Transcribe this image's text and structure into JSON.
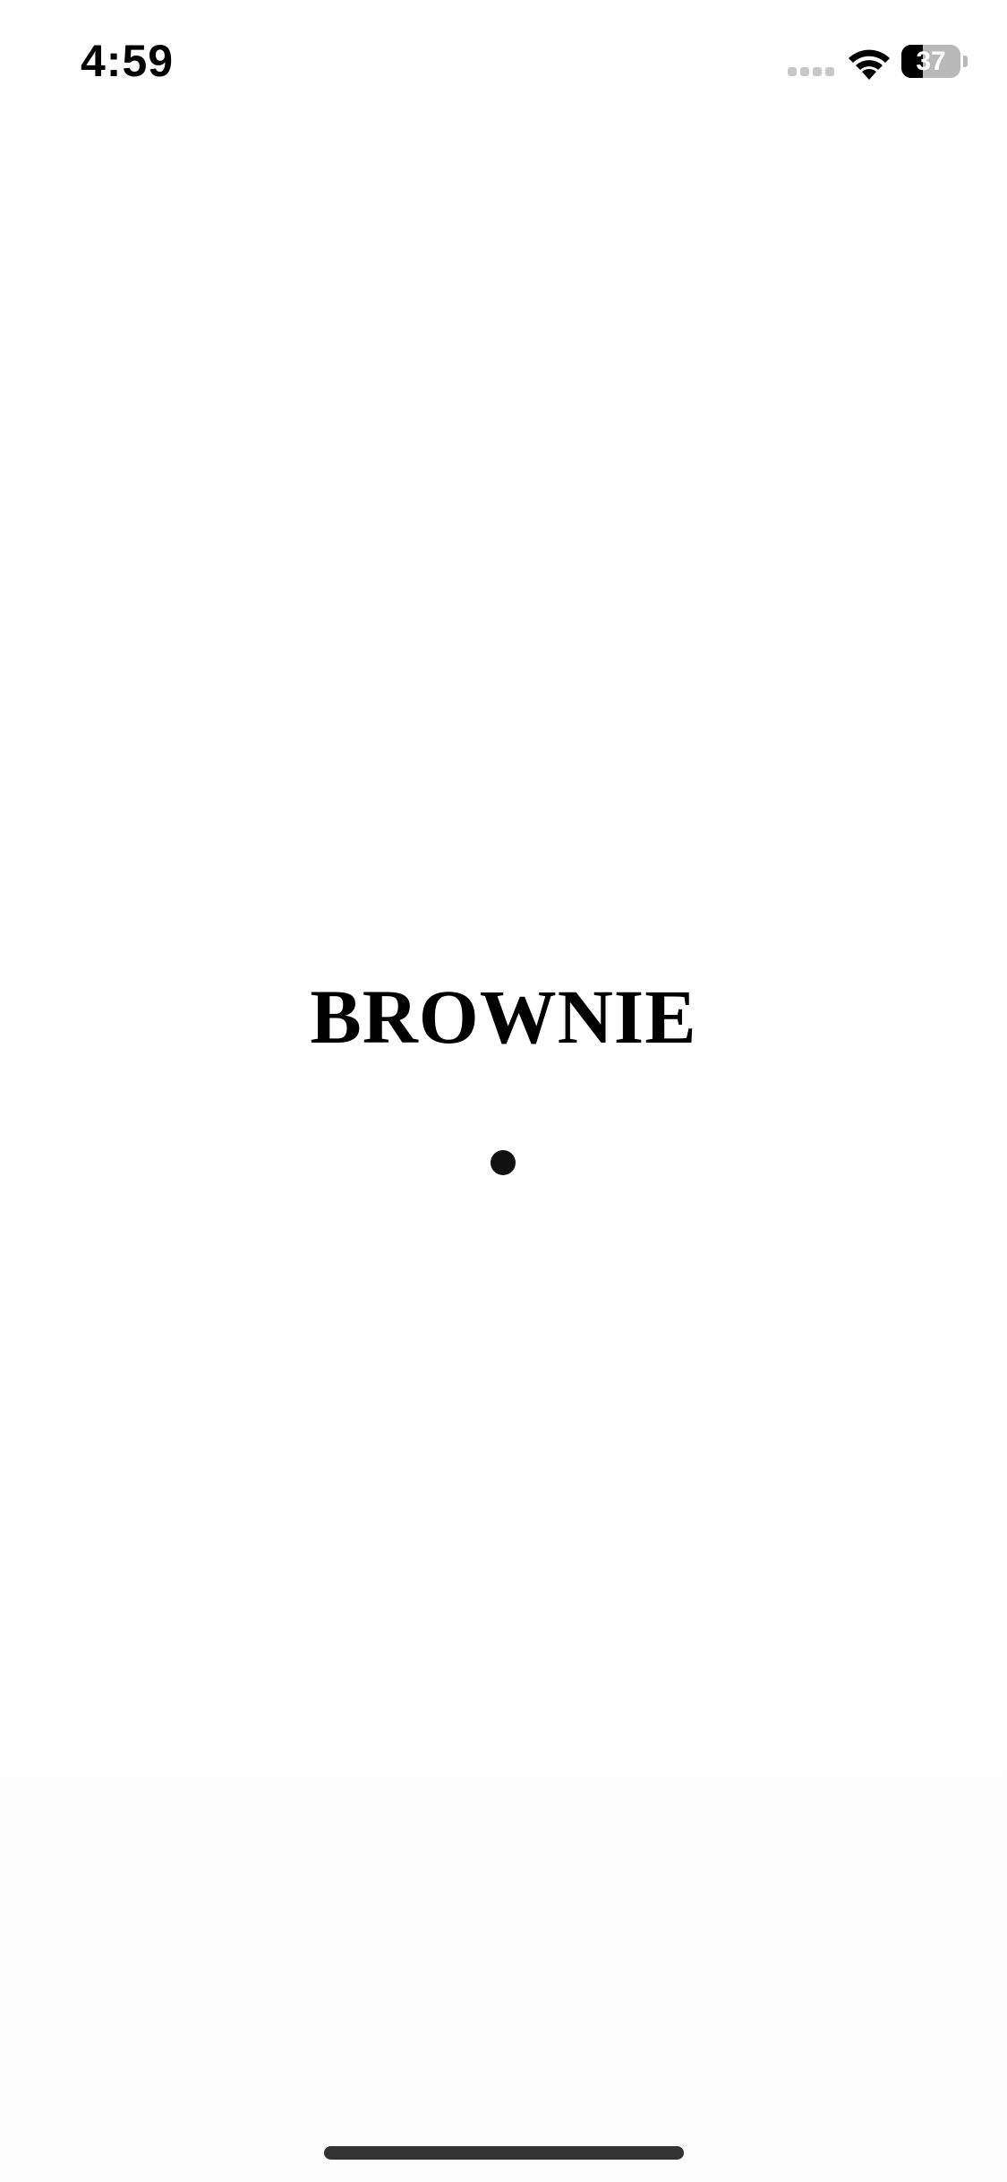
{
  "status_bar": {
    "time": "4:59",
    "battery_level": "37",
    "battery_fraction": 0.37,
    "signal_icon": "cellular-signal-icon",
    "wifi_icon": "wifi-icon",
    "battery_icon": "battery-icon"
  },
  "splash": {
    "title": "BROWNIE",
    "indicator_icon": "loading-dot-icon"
  },
  "colors": {
    "background": "#ffffff",
    "text": "#000000",
    "home_indicator": "#333333"
  }
}
